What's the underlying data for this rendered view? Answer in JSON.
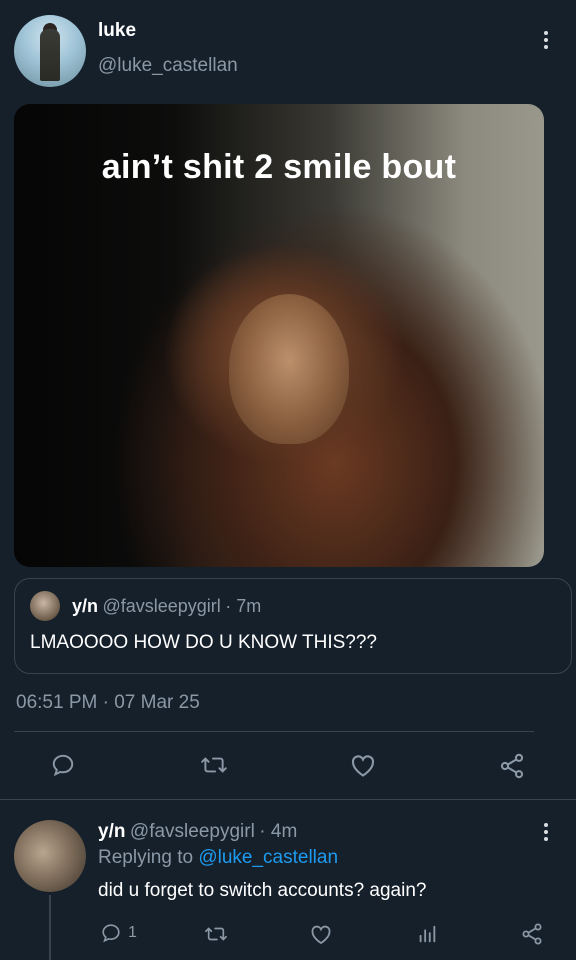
{
  "tweet": {
    "author_name": "luke",
    "author_handle": "@luke_castellan",
    "media_caption": "ain’t shit 2 smile bout",
    "quote": {
      "name": "y/n",
      "handle": "@favsleepygirl",
      "time": "· 7m",
      "text": "LMAOOOO HOW DO U KNOW THIS???"
    },
    "timestamp": "06:51 PM · 07 Mar 25"
  },
  "actions": [
    "reply-icon",
    "retweet-icon",
    "like-icon",
    "share-icon"
  ],
  "reply": {
    "name": "y/n",
    "handle": "@favsleepygirl",
    "time": "· 4m",
    "replying_prefix": "Replying to",
    "replying_to": "@luke_castellan",
    "text": "did u forget to switch accounts? again?",
    "reply_count": "1"
  },
  "colors": {
    "background": "#15202b",
    "muted": "#8b98a5",
    "link": "#1d9bf0",
    "border": "#38444d"
  }
}
